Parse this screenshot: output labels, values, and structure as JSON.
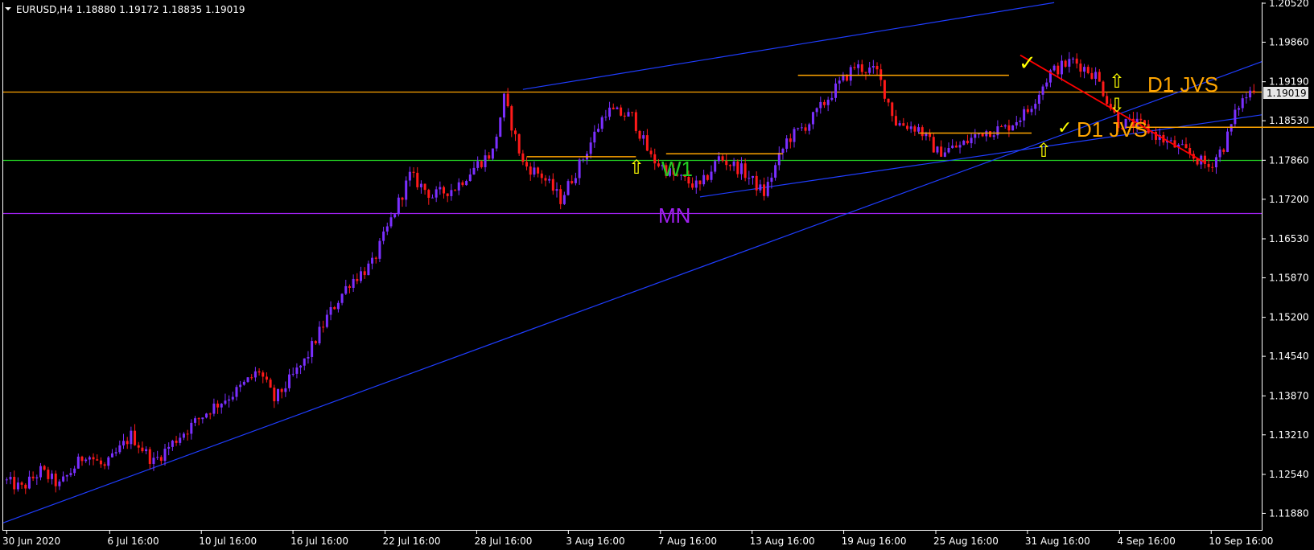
{
  "header": {
    "symbol_line": "EURUSD,H4  1.18880 1.19172 1.18835 1.19019"
  },
  "colors": {
    "background": "#000000",
    "axis": "#ffffff",
    "bull_candle": "#7b2fff",
    "bear_candle": "#ff1a1a",
    "trend_line": "#1f3dff",
    "orange_level": "#ffa500",
    "w1_level": "#22cc22",
    "mn_level": "#a020f0",
    "red_trend": "#ff0000",
    "current_price_tag": "#e6e6e6"
  },
  "chart_data": {
    "type": "candlestick",
    "title": "EURUSD,H4",
    "ohlc_header": {
      "open": 1.1888,
      "high": 1.19172,
      "low": 1.18835,
      "close": 1.19019
    },
    "current_price": 1.19019,
    "ylim": [
      1.116,
      1.2052
    ],
    "y_ticks": [
      "1.20520",
      "1.19860",
      "1.19190",
      "1.18530",
      "1.17860",
      "1.17200",
      "1.16530",
      "1.15870",
      "1.15200",
      "1.14540",
      "1.13870",
      "1.13210",
      "1.12540",
      "1.11880"
    ],
    "x_ticks": [
      "30 Jun 2020",
      "6 Jul 16:00",
      "10 Jul 16:00",
      "16 Jul 16:00",
      "22 Jul 16:00",
      "28 Jul 16:00",
      "3 Aug 16:00",
      "7 Aug 16:00",
      "13 Aug 16:00",
      "19 Aug 16:00",
      "25 Aug 16:00",
      "31 Aug 16:00",
      "4 Sep 16:00",
      "10 Sep 16:00"
    ],
    "x_tick_positions": [
      0,
      22.7,
      42.9,
      63.1,
      83.4,
      103.6,
      123.8,
      144.1,
      164.3,
      184.5,
      204.8,
      225,
      245.3,
      265.5
    ],
    "bars_visible": 278,
    "price_path_anchors": [
      [
        0,
        1.1245
      ],
      [
        5,
        1.123
      ],
      [
        10,
        1.126
      ],
      [
        15,
        1.1235
      ],
      [
        22,
        1.129
      ],
      [
        27,
        1.1265
      ],
      [
        34,
        1.132
      ],
      [
        40,
        1.1275
      ],
      [
        47,
        1.132
      ],
      [
        55,
        1.1365
      ],
      [
        62,
        1.1395
      ],
      [
        68,
        1.143
      ],
      [
        72,
        1.138
      ],
      [
        80,
        1.1445
      ],
      [
        86,
        1.152
      ],
      [
        92,
        1.158
      ],
      [
        98,
        1.161
      ],
      [
        104,
        1.17
      ],
      [
        108,
        1.176
      ],
      [
        114,
        1.1725
      ],
      [
        120,
        1.174
      ],
      [
        126,
        1.178
      ],
      [
        130,
        1.18
      ],
      [
        133,
        1.189
      ],
      [
        138,
        1.178
      ],
      [
        143,
        1.176
      ],
      [
        148,
        1.172
      ],
      [
        154,
        1.179
      ],
      [
        160,
        1.187
      ],
      [
        167,
        1.186
      ],
      [
        172,
        1.179
      ],
      [
        178,
        1.176
      ],
      [
        185,
        1.174
      ],
      [
        190,
        1.179
      ],
      [
        196,
        1.177
      ],
      [
        202,
        1.173
      ],
      [
        208,
        1.182
      ],
      [
        214,
        1.185
      ],
      [
        220,
        1.19
      ],
      [
        226,
        1.1945
      ],
      [
        232,
        1.1935
      ],
      [
        237,
        1.185
      ],
      [
        243,
        1.184
      ],
      [
        248,
        1.18
      ],
      [
        254,
        1.181
      ],
      [
        260,
        1.1835
      ],
      [
        266,
        1.184
      ],
      [
        272,
        1.187
      ],
      [
        278,
        1.1935
      ],
      [
        284,
        1.1955
      ],
      [
        290,
        1.193
      ],
      [
        296,
        1.185
      ],
      [
        302,
        1.1845
      ],
      [
        308,
        1.182
      ],
      [
        314,
        1.18
      ],
      [
        320,
        1.1775
      ],
      [
        324,
        1.181
      ],
      [
        328,
        1.188
      ],
      [
        331,
        1.1902
      ]
    ],
    "horizontal_levels": [
      {
        "name": "D1 JVS",
        "value": 1.19019,
        "color": "orange"
      },
      {
        "name": "W1",
        "value": 1.1786,
        "color": "green"
      },
      {
        "name": "MN",
        "value": 1.1697,
        "color": "purple"
      }
    ],
    "annotations": [
      {
        "text": "D1 JVS",
        "near_level": 1.19
      },
      {
        "text": "D1 JVS",
        "near_level": 1.1842
      },
      {
        "text": "W1",
        "near_level": 1.1786
      },
      {
        "text": "MN",
        "near_level": 1.1697
      }
    ],
    "marks": {
      "check": "✓",
      "arrow_up": "⇧",
      "arrow_down": "⇩"
    }
  }
}
